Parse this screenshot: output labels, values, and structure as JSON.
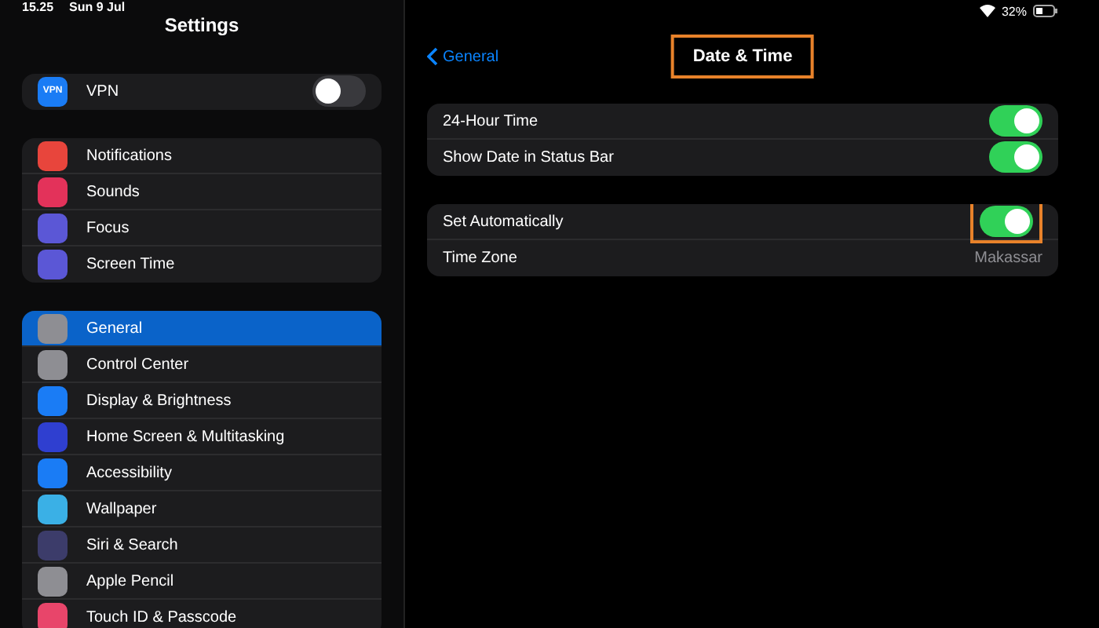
{
  "status_bar": {
    "time": "15.25",
    "date": "Sun 9 Jul",
    "battery": "32%"
  },
  "sidebar": {
    "title": "Settings",
    "groups": [
      [
        {
          "label": "VPN",
          "icon_text": "VPN",
          "color": "#1a7cf5",
          "kind": "toggle",
          "on": false,
          "selected": false
        }
      ],
      [
        {
          "label": "Notifications",
          "color": "#e8453c",
          "kind": "link",
          "selected": false
        },
        {
          "label": "Sounds",
          "color": "#e3325a",
          "kind": "link",
          "selected": false
        },
        {
          "label": "Focus",
          "color": "#5b57d6",
          "kind": "link",
          "selected": false
        },
        {
          "label": "Screen Time",
          "color": "#5b57d6",
          "kind": "link",
          "selected": false
        }
      ],
      [
        {
          "label": "General",
          "color": "#8e8e93",
          "kind": "link",
          "selected": true
        },
        {
          "label": "Control Center",
          "color": "#8e8e93",
          "kind": "link",
          "selected": false
        },
        {
          "label": "Display & Brightness",
          "color": "#1a7cf5",
          "kind": "link",
          "selected": false
        },
        {
          "label": "Home Screen & Multitasking",
          "color": "#2f3fd0",
          "kind": "link",
          "selected": false
        },
        {
          "label": "Accessibility",
          "color": "#1a7cf5",
          "kind": "link",
          "selected": false
        },
        {
          "label": "Wallpaper",
          "color": "#3ab0e6",
          "kind": "link",
          "selected": false
        },
        {
          "label": "Siri & Search",
          "color": "#3c3c6a",
          "kind": "link",
          "selected": false
        },
        {
          "label": "Apple Pencil",
          "color": "#8e8e93",
          "kind": "link",
          "selected": false
        },
        {
          "label": "Touch ID & Passcode",
          "color": "#e8456a",
          "kind": "link",
          "selected": false
        }
      ]
    ]
  },
  "detail": {
    "back": "General",
    "title": "Date & Time",
    "title_highlighted": true,
    "groups": [
      [
        {
          "label": "24-Hour Time",
          "kind": "toggle",
          "on": true,
          "highlighted": false
        },
        {
          "label": "Show Date in Status Bar",
          "kind": "toggle",
          "on": true,
          "highlighted": false
        }
      ],
      [
        {
          "label": "Set Automatically",
          "kind": "toggle",
          "on": true,
          "highlighted": true
        },
        {
          "label": "Time Zone",
          "kind": "value",
          "value": "Makassar"
        }
      ]
    ]
  }
}
